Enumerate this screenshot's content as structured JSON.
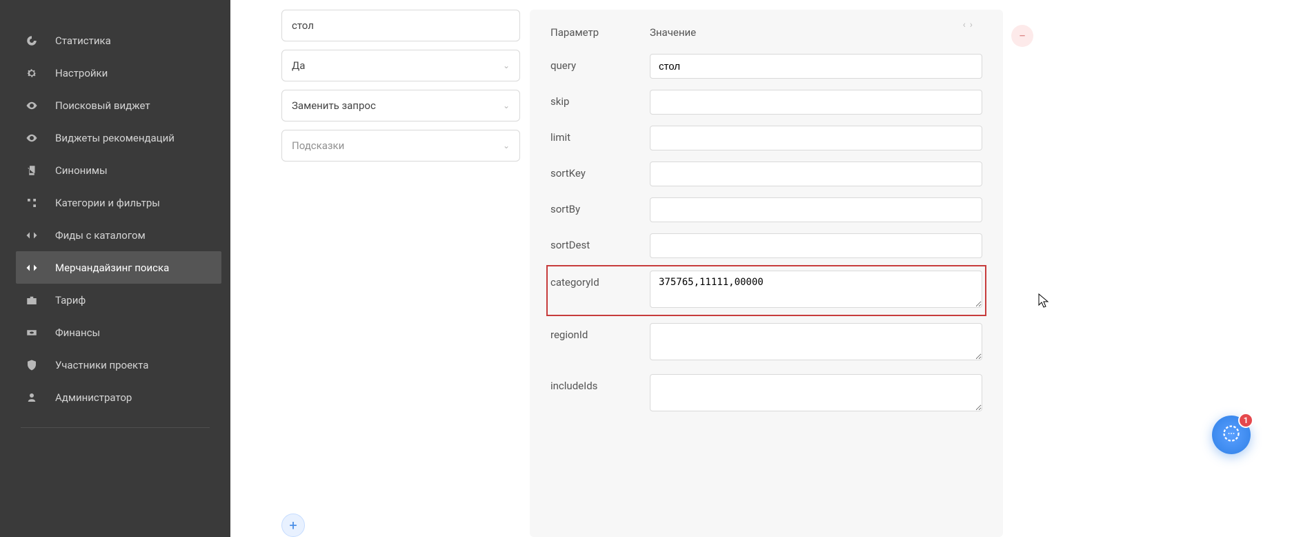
{
  "sidebar": {
    "items": [
      {
        "label": "Статистика",
        "icon": "donut"
      },
      {
        "label": "Настройки",
        "icon": "gear"
      },
      {
        "label": "Поисковый виджет",
        "icon": "eye"
      },
      {
        "label": "Виджеты рекомендаций",
        "icon": "eye"
      },
      {
        "label": "Синонимы",
        "icon": "copy"
      },
      {
        "label": "Категории и фильтры",
        "icon": "tree"
      },
      {
        "label": "Фиды с каталогом",
        "icon": "code"
      },
      {
        "label": "Мерчандайзинг поиска",
        "icon": "code",
        "active": true
      },
      {
        "label": "Тариф",
        "icon": "briefcase"
      },
      {
        "label": "Финансы",
        "icon": "cash"
      },
      {
        "label": "Участники проекта",
        "icon": "shield"
      },
      {
        "label": "Администратор",
        "icon": "person"
      }
    ]
  },
  "left_controls": {
    "input_value": "стол",
    "select1": "Да",
    "select2": "Заменить запрос",
    "select3": "Подсказки"
  },
  "panel": {
    "header_param": "Параметр",
    "header_value": "Значение",
    "rows": [
      {
        "name": "query",
        "value": "стол",
        "type": "text"
      },
      {
        "name": "skip",
        "value": "",
        "type": "text"
      },
      {
        "name": "limit",
        "value": "",
        "type": "text"
      },
      {
        "name": "sortKey",
        "value": "",
        "type": "text"
      },
      {
        "name": "sortBy",
        "value": "",
        "type": "text"
      },
      {
        "name": "sortDest",
        "value": "",
        "type": "text"
      },
      {
        "name": "categoryId",
        "value": "375765,11111,00000",
        "type": "textarea",
        "highlighted": true
      },
      {
        "name": "regionId",
        "value": "",
        "type": "textarea"
      },
      {
        "name": "includeIds",
        "value": "",
        "type": "textarea"
      }
    ]
  },
  "chat": {
    "badge": "1"
  }
}
